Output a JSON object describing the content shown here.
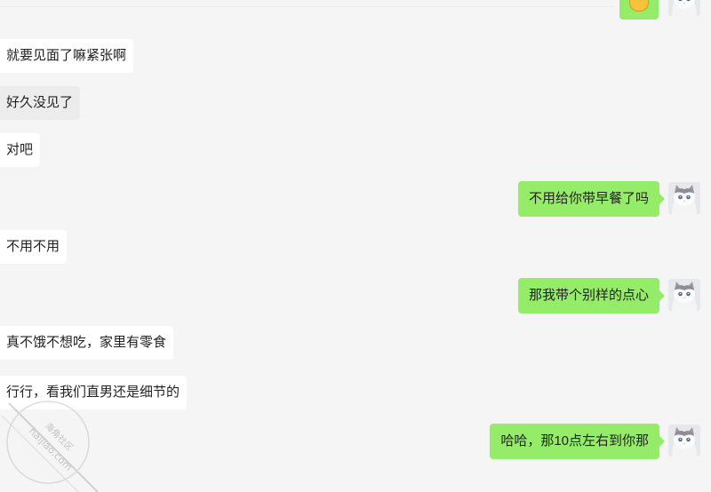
{
  "messages": [
    {
      "side": "received",
      "text": "就要见面了嘛紧张啊"
    },
    {
      "side": "received",
      "text": "好久没见了"
    },
    {
      "side": "received",
      "text": "对吧"
    },
    {
      "side": "sent",
      "text": "不用给你带早餐了吗"
    },
    {
      "side": "received",
      "text": "不用不用"
    },
    {
      "side": "sent",
      "text": "那我带个别样的点心"
    },
    {
      "side": "received",
      "text": "真不饿不想吃，家里有零食"
    },
    {
      "side": "received",
      "text": "行行，看我们直男还是细节的"
    },
    {
      "side": "sent",
      "text": "哈哈，那10点左右到你那"
    }
  ],
  "watermark": {
    "line1": "海角社区",
    "line2": "haijiao.com"
  },
  "colors": {
    "background": "#f5f5f6",
    "sent_bubble": "#95ec69",
    "received_bubble": "#ffffff"
  },
  "icons": {
    "avatar": "white-cat-avatar-icon",
    "top_emoji": "emoji-icon"
  }
}
